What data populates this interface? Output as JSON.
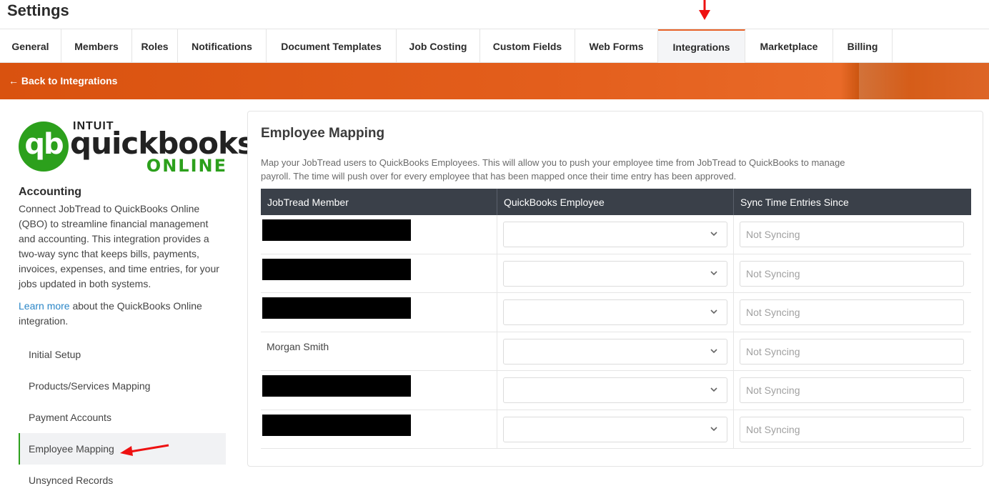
{
  "page": {
    "title": "Settings"
  },
  "tabs": [
    {
      "label": "General",
      "active": false
    },
    {
      "label": "Members",
      "active": false
    },
    {
      "label": "Roles",
      "active": false
    },
    {
      "label": "Notifications",
      "active": false
    },
    {
      "label": "Document Templates",
      "active": false
    },
    {
      "label": "Job Costing",
      "active": false
    },
    {
      "label": "Custom Fields",
      "active": false
    },
    {
      "label": "Web Forms",
      "active": false
    },
    {
      "label": "Integrations",
      "active": true
    },
    {
      "label": "Marketplace",
      "active": false
    },
    {
      "label": "Billing",
      "active": false
    }
  ],
  "banner": {
    "back_label": "← Back to Integrations"
  },
  "logo": {
    "intuit": "INTUIT",
    "brand": "quickbooks",
    "online": "ONLINE",
    "mark": "qb"
  },
  "accounting": {
    "heading": "Accounting",
    "description": "Connect JobTread to QuickBooks Online (QBO) to streamline financial management and accounting. This integration provides a two-way sync that keeps bills, payments, invoices, expenses, and time entries, for your jobs updated in both systems.",
    "learn_more_link": "Learn more",
    "learn_more_rest": " about the QuickBooks Online integration."
  },
  "sidenav": [
    {
      "label": "Initial Setup",
      "active": false
    },
    {
      "label": "Products/Services Mapping",
      "active": false
    },
    {
      "label": "Payment Accounts",
      "active": false
    },
    {
      "label": "Employee Mapping",
      "active": true
    },
    {
      "label": "Unsynced Records",
      "active": false
    }
  ],
  "mapping": {
    "title": "Employee Mapping",
    "description": "Map your JobTread users to QuickBooks Employees. This will allow you to push your employee time from JobTread to QuickBooks to manage payroll. The time will push over for every employee that has been mapped once their time entry has been approved.",
    "columns": [
      "JobTread Member",
      "QuickBooks Employee",
      "Sync Time Entries Since"
    ],
    "sync_placeholder": "Not Syncing",
    "rows": [
      {
        "member": "",
        "redacted": true
      },
      {
        "member": "",
        "redacted": true
      },
      {
        "member": "",
        "redacted": true
      },
      {
        "member": "Morgan Smith",
        "redacted": false
      },
      {
        "member": "",
        "redacted": true
      },
      {
        "member": "",
        "redacted": true
      }
    ]
  },
  "colors": {
    "accent": "#e8632a",
    "brand_green": "#2ca01c",
    "header_dark": "#3a4049"
  },
  "icons": {
    "select": "chevron-down-icon",
    "annotation": "red-arrow-icon"
  }
}
